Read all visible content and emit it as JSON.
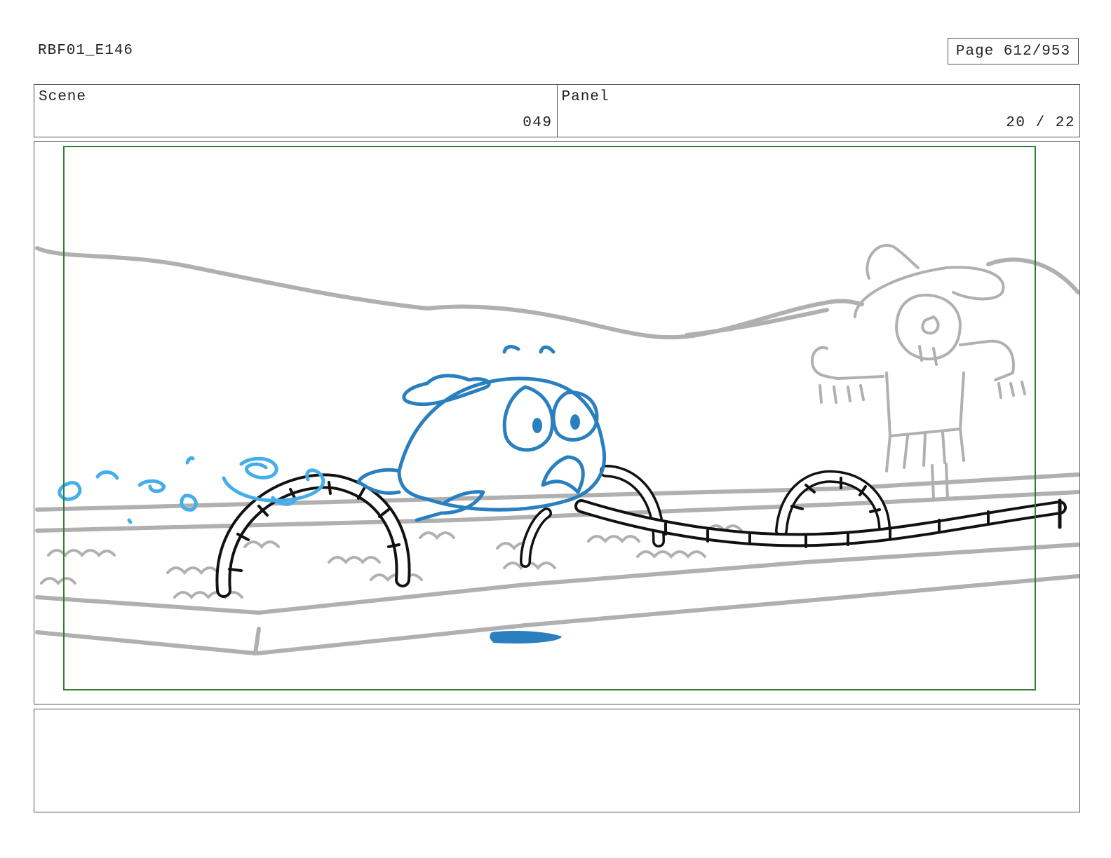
{
  "header": {
    "doc_id": "RBF01_E146",
    "page_label": "Page 612/953"
  },
  "info": {
    "scene_label": "Scene",
    "scene_value": "049",
    "panel_label": "Panel",
    "panel_value": "20 / 22"
  },
  "panel": {
    "safe_frame_color": "#2e7d32",
    "character_color": "#2a7fbf",
    "splash_color": "#45aeea",
    "background_color": "#b0b0b0",
    "hose_color": "#111111"
  },
  "notes": {
    "text": ""
  }
}
